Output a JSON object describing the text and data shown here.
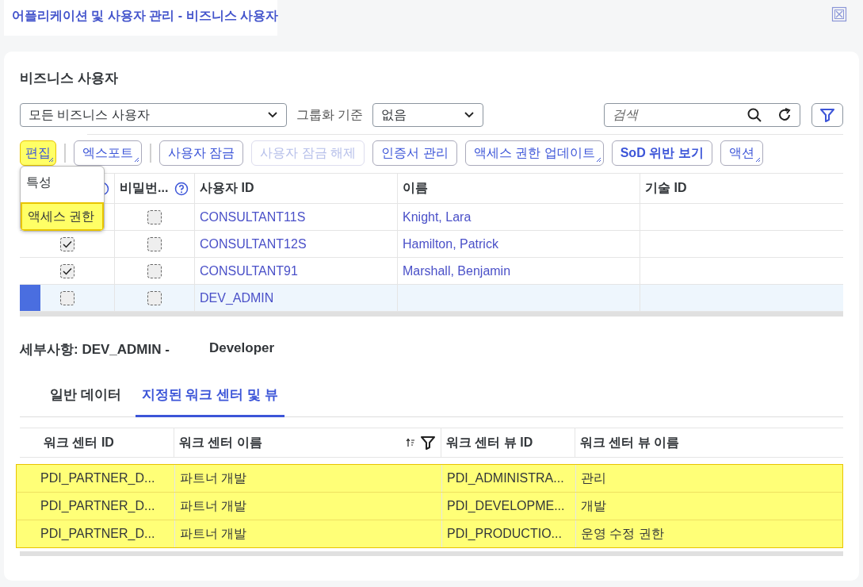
{
  "window": {
    "title": "어플리케이션 및 사용자 관리 - 비즈니스 사용자"
  },
  "section_title": "비즈니스 사용자",
  "filters": {
    "view": "모든 비즈니스 사용자",
    "group_label": "그룹화 기준",
    "group_value": "없음",
    "search": {
      "placeholder": "검색"
    }
  },
  "toolbar": [
    {
      "label": "편집",
      "menu": true,
      "disabled": false,
      "bold": false,
      "highlighted": true,
      "separator_after": true
    },
    {
      "label": "엑스포트",
      "menu": true,
      "disabled": false,
      "bold": false,
      "highlighted": false,
      "separator_after": true
    },
    {
      "label": "사용자 잠금",
      "menu": false,
      "disabled": false,
      "bold": false,
      "highlighted": false
    },
    {
      "label": "사용자 잠금 해제",
      "menu": false,
      "disabled": true,
      "bold": false,
      "highlighted": false
    },
    {
      "label": "인증서 관리",
      "menu": false,
      "disabled": false,
      "bold": false,
      "highlighted": false
    },
    {
      "label": "액세스 권한 업데이트",
      "menu": true,
      "disabled": false,
      "bold": false,
      "highlighted": false
    },
    {
      "label": "SoD 위반 보기",
      "menu": false,
      "disabled": false,
      "bold": true,
      "highlighted": false
    },
    {
      "label": "액션",
      "menu": true,
      "disabled": false,
      "bold": false,
      "highlighted": false
    }
  ],
  "edit_menu": [
    {
      "label": "특성",
      "highlighted": false
    },
    {
      "label": "액세스 권한",
      "highlighted": true
    }
  ],
  "users_table": {
    "columns": [
      {
        "help": true
      },
      {
        "label": "비밀번...",
        "help": true
      },
      {
        "label": "사용자 ID"
      },
      {
        "label": "이름"
      },
      {
        "label": "기술 ID"
      }
    ],
    "rows": [
      {
        "col2_checked": false,
        "user_id": "CONSULTANT11S",
        "name": "Knight, Lara",
        "selected": false
      },
      {
        "col1_checked": true,
        "col2_checked": false,
        "user_id": "CONSULTANT12S",
        "name": "Hamilton, Patrick",
        "selected": false
      },
      {
        "col1_checked": true,
        "col2_checked": false,
        "user_id": "CONSULTANT91",
        "name": "Marshall, Benjamin",
        "selected": false
      },
      {
        "col1_checked": false,
        "col2_checked": false,
        "user_id": "DEV_ADMIN",
        "selected": true
      }
    ]
  },
  "details": {
    "title": "세부사항: DEV_ADMIN -",
    "subtitle": "Developer",
    "tabs": [
      {
        "label": "일반 데이터",
        "selected": false
      },
      {
        "label": "지정된 워크 센터 및 뷰",
        "selected": true
      }
    ],
    "table": {
      "columns": [
        {
          "label": "워크 센터 ID"
        },
        {
          "label": "워크 센터 이름",
          "tools": true
        },
        {
          "label": "워크 센터 뷰 ID"
        },
        {
          "label": "워크 센터 뷰 이름"
        }
      ],
      "rows": [
        {
          "cells": [
            "PDI_PARTNER_D...",
            "파트너 개발",
            "PDI_ADMINISTRA...",
            "관리"
          ],
          "highlighted": true
        },
        {
          "cells": [
            "PDI_PARTNER_D...",
            "파트너 개발",
            "PDI_DEVELOPME...",
            "개발"
          ],
          "highlighted": true
        },
        {
          "cells": [
            "PDI_PARTNER_D...",
            "파트너 개발",
            "PDI_PRODUCTIO...",
            "운영 수정 권한"
          ],
          "highlighted": true
        }
      ]
    }
  }
}
